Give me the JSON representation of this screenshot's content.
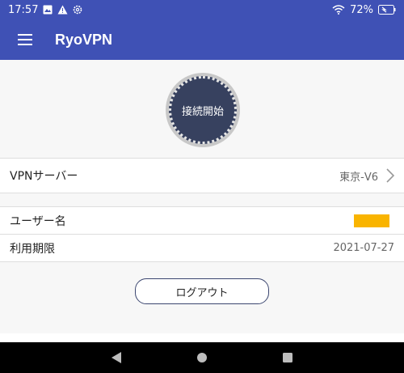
{
  "status_bar": {
    "time": "17:57",
    "battery": "72%",
    "icons": [
      "image-icon",
      "warning-icon",
      "settings-icon",
      "wifi-icon",
      "battery-icon"
    ]
  },
  "app_bar": {
    "title": "RyoVPN",
    "menu_icon": "menu-icon"
  },
  "connect": {
    "label": "接続開始"
  },
  "server": {
    "label": "VPNサーバー",
    "value": "東京-V6"
  },
  "account": {
    "username_label": "ユーザー名",
    "username_value": "",
    "expiry_label": "利用期限",
    "expiry_value": "2021-07-27"
  },
  "logout": {
    "label": "ログアウト"
  },
  "colors": {
    "primary": "#3f51b5",
    "connect_button": "#37415f",
    "highlight": "#f9b400"
  },
  "nav_bar": {
    "icons": [
      "back-icon",
      "home-icon",
      "recents-icon"
    ]
  }
}
